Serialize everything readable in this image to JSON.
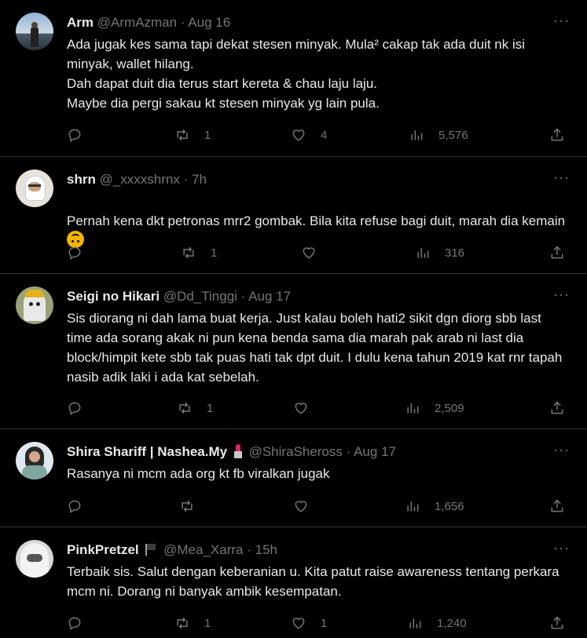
{
  "tweets": [
    {
      "name": "Arm",
      "handle": "@ArmAzman",
      "time": "Aug 16",
      "text": "Ada jugak kes sama tapi dekat stesen minyak. Mula² cakap tak ada duit nk isi minyak, wallet hilang.\nDah dapat duit dia terus start kereta & chau laju laju.\nMaybe dia pergi sakau kt stesen minyak yg lain pula.",
      "replies": "",
      "retweets": "1",
      "likes": "4",
      "views": "5,576"
    },
    {
      "name": "shrn",
      "handle": "@_xxxxshrnx",
      "time": "7h",
      "text": "Pernah kena dkt petronas mrr2 gombak. Bila kita refuse bagi duit, marah dia kemain",
      "replies": "",
      "retweets": "1",
      "likes": "",
      "views": "316"
    },
    {
      "name": "Seigi no Hikari",
      "handle": "@Dd_Tinggi",
      "time": "Aug 17",
      "text": "Sis diorang ni dah lama buat kerja. Just kalau boleh hati2 sikit dgn diorg sbb last time ada sorang akak ni pun kena benda sama dia marah pak arab ni last dia block/himpit kete sbb tak puas hati tak dpt duit. I dulu kena tahun 2019 kat rnr tapah nasib adik laki i ada kat sebelah.",
      "replies": "",
      "retweets": "1",
      "likes": "",
      "views": "2,509"
    },
    {
      "name": "Shira Shariff | Nashea.My",
      "handle": "@ShiraSheross",
      "time": "Aug 17",
      "text": "Rasanya ni mcm ada org kt fb viralkan jugak",
      "replies": "",
      "retweets": "",
      "likes": "",
      "views": "1,656"
    },
    {
      "name": "PinkPretzel",
      "handle": "@Mea_Xarra",
      "time": "15h",
      "text": "Terbaik sis. Salut dengan keberanian u. Kita patut raise awareness tentang perkara mcm ni. Dorang ni banyak ambik kesempatan.",
      "replies": "",
      "retweets": "1",
      "likes": "1",
      "views": "1,240"
    }
  ],
  "separator": "·",
  "more_label": "···"
}
